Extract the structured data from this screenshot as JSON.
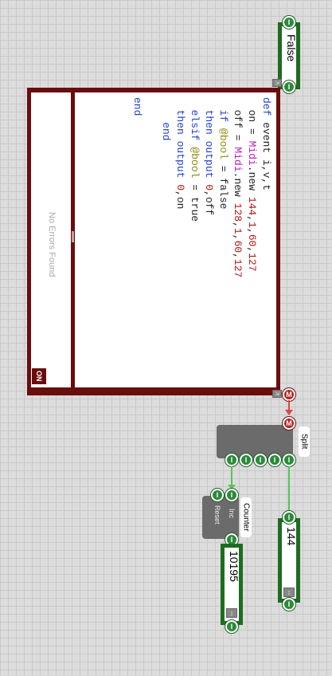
{
  "false_node": {
    "value": "False"
  },
  "code_node": {
    "error_text": "No Errors Found",
    "on_label": "ON",
    "lines": [
      [
        {
          "t": "def",
          "c": "kw"
        },
        {
          "t": " event i,v,t",
          "c": "plain"
        }
      ],
      [
        {
          "t": "  on = ",
          "c": "plain"
        },
        {
          "t": "Midi",
          "c": "inst"
        },
        {
          "t": ".new ",
          "c": "plain"
        },
        {
          "t": "144",
          "c": "num"
        },
        {
          "t": ",",
          "c": "plain"
        },
        {
          "t": "1",
          "c": "num"
        },
        {
          "t": ",",
          "c": "plain"
        },
        {
          "t": "60",
          "c": "num"
        },
        {
          "t": ",",
          "c": "plain"
        },
        {
          "t": "127",
          "c": "num"
        }
      ],
      [
        {
          "t": "  off = ",
          "c": "plain"
        },
        {
          "t": "Midi",
          "c": "inst"
        },
        {
          "t": ".new ",
          "c": "plain"
        },
        {
          "t": "128",
          "c": "num"
        },
        {
          "t": ",",
          "c": "plain"
        },
        {
          "t": "1",
          "c": "num"
        },
        {
          "t": ",",
          "c": "plain"
        },
        {
          "t": "60",
          "c": "num"
        },
        {
          "t": ",",
          "c": "plain"
        },
        {
          "t": "127",
          "c": "num"
        }
      ],
      [
        {
          "t": "  if ",
          "c": "kw"
        },
        {
          "t": "@bool",
          "c": "var"
        },
        {
          "t": " = false",
          "c": "plain"
        }
      ],
      [
        {
          "t": "  then ",
          "c": "kw"
        },
        {
          "t": "output ",
          "c": "kw"
        },
        {
          "t": "0",
          "c": "num"
        },
        {
          "t": ",off",
          "c": "plain"
        }
      ],
      [
        {
          "t": "  elsif ",
          "c": "kw"
        },
        {
          "t": "@bool",
          "c": "var"
        },
        {
          "t": " = true",
          "c": "plain"
        }
      ],
      [
        {
          "t": "  then ",
          "c": "kw"
        },
        {
          "t": "output ",
          "c": "kw"
        },
        {
          "t": "0",
          "c": "num"
        },
        {
          "t": ",on",
          "c": "plain"
        }
      ],
      [
        {
          "t": "    end",
          "c": "kw"
        }
      ],
      [
        {
          "t": "",
          "c": "plain"
        }
      ],
      [
        {
          "t": "end",
          "c": "kw"
        }
      ]
    ]
  },
  "split_node": {
    "label": "Split"
  },
  "counter_node": {
    "label": "Counter",
    "inc_label": "Inc",
    "reset_label": "Reset"
  },
  "value_144": {
    "value": "144"
  },
  "value_10195": {
    "value": "10195"
  },
  "port_labels": {
    "i": "I",
    "m": "M"
  },
  "colors": {
    "wire": "#56c35a",
    "node_border": "#1f6b21",
    "code_frame": "#6a0d0d",
    "red_port": "#b02323"
  }
}
